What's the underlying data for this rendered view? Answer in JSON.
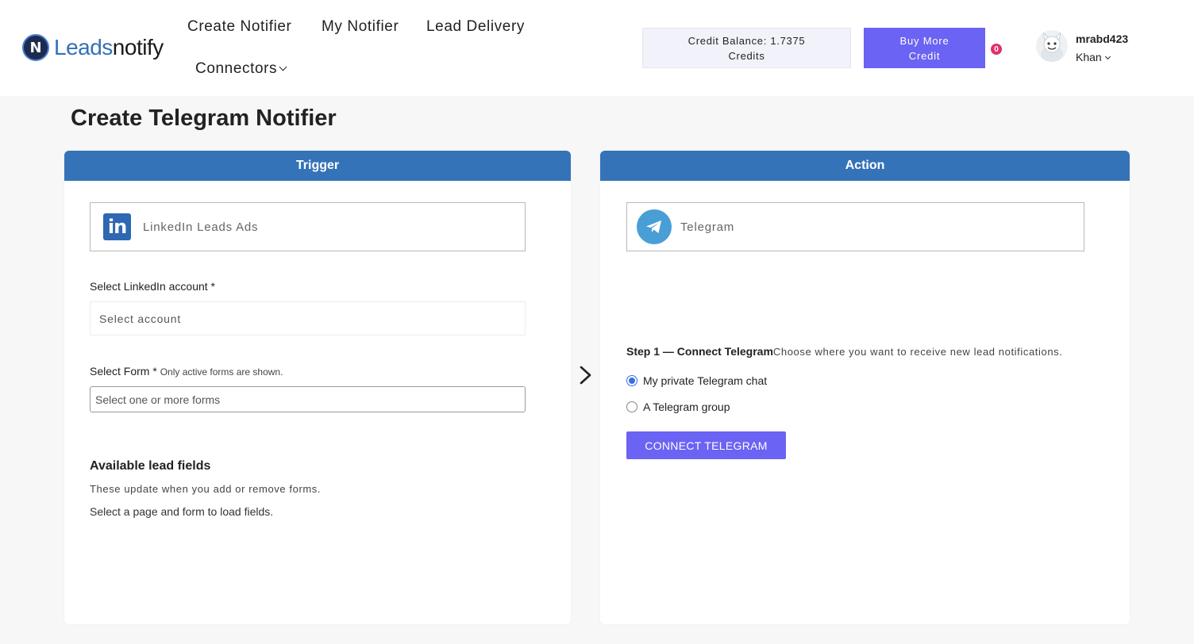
{
  "header": {
    "logo_leads": "Leads",
    "logo_notify": "notify",
    "logo_mark": "N",
    "nav": {
      "create_notifier": "Create Notifier",
      "my_notifier": "My Notifier",
      "lead_delivery": "Lead Delivery",
      "connectors": "Connectors"
    },
    "credit_balance": "Credit Balance: 1.7375 Credits",
    "buy_more": "Buy More Credit",
    "notification_count": "0",
    "user": {
      "username": "mrabd423",
      "name": "Khan"
    }
  },
  "page": {
    "title": "Create Telegram Notifier"
  },
  "trigger": {
    "header": "Trigger",
    "app_name": "LinkedIn Leads Ads",
    "app_icon": "linkedin-icon",
    "account_label": "Select LinkedIn account *",
    "account_placeholder": "Select account",
    "form_label": "Select Form *",
    "form_hint": "Only active forms are shown.",
    "form_placeholder": "Select one or more forms",
    "fields_title": "Available lead fields",
    "fields_sub": "These update when you add or remove forms.",
    "fields_note": "Select a page and form to load fields."
  },
  "action": {
    "header": "Action",
    "app_name": "Telegram",
    "app_icon": "telegram-icon",
    "step_title": "Step 1 — Connect Telegram",
    "step_desc": "Choose where you want to receive new lead notifications.",
    "options": [
      {
        "label": "My private Telegram chat",
        "checked": true
      },
      {
        "label": "A Telegram group",
        "checked": false
      }
    ],
    "connect_label": "CONNECT TELEGRAM"
  },
  "colors": {
    "brand_blue": "#3573b8",
    "accent_purple": "#6b63f3",
    "badge_red": "#e0306a",
    "radio_blue": "#3a6fe0"
  }
}
